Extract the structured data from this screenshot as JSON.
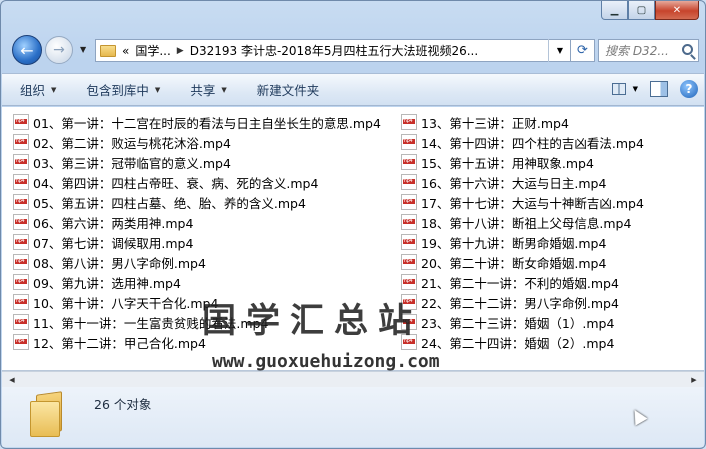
{
  "window": {
    "caption_icons": [
      "minimize-icon",
      "maximize-icon",
      "close-icon"
    ]
  },
  "nav": {
    "back_glyph": "←",
    "forward_glyph": "→",
    "address": {
      "prefix": "«",
      "segments": [
        "国学...",
        "D32193 李计忠-2018年5月四柱五行大法班视频26..."
      ]
    },
    "search_placeholder": "搜索 D32..."
  },
  "toolbar": {
    "organize": "组织",
    "include_library": "包含到库中",
    "share": "共享",
    "new_folder": "新建文件夹",
    "help": "?"
  },
  "files": {
    "left": [
      "01、第一讲：十二宫在时辰的看法与日主自坐长生的意思.mp4",
      "02、第二讲：败运与桃花沐浴.mp4",
      "03、第三讲：冠带临官的意义.mp4",
      "04、第四讲：四柱占帝旺、衰、病、死的含义.mp4",
      "05、第五讲：四柱占墓、绝、胎、养的含义.mp4",
      "06、第六讲：两类用神.mp4",
      "07、第七讲：调候取用.mp4",
      "08、第八讲：男八字命例.mp4",
      "09、第九讲：选用神.mp4",
      "10、第十讲：八字天干合化.mp4",
      "11、第十一讲：一生富贵贫贱的看法.mp4",
      "12、第十二讲：甲己合化.mp4"
    ],
    "right": [
      "13、第十三讲：正财.mp4",
      "14、第十四讲：四个柱的吉凶看法.mp4",
      "15、第十五讲：用神取象.mp4",
      "16、第十六讲：大运与日主.mp4",
      "17、第十七讲：大运与十神断吉凶.mp4",
      "18、第十八讲：断祖上父母信息.mp4",
      "19、第十九讲：断男命婚姻.mp4",
      "20、第二十讲：断女命婚姻.mp4",
      "21、第二十一讲：不利的婚姻.mp4",
      "22、第二十二讲：男八字命例.mp4",
      "23、第二十三讲：婚姻（1）.mp4",
      "24、第二十四讲：婚姻（2）.mp4"
    ]
  },
  "watermark": {
    "title": "国学汇总站",
    "url": "www.guoxuehuizong.com"
  },
  "details": {
    "count": "26 个对象"
  }
}
